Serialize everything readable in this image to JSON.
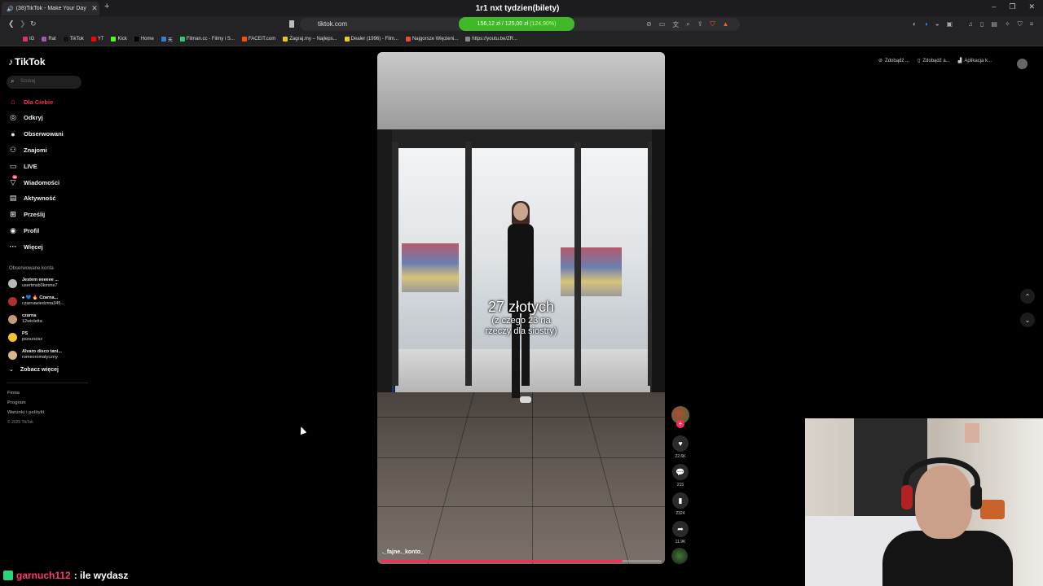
{
  "browser": {
    "tab_title": "(38)TikTok - Make Your Day",
    "tab_close": "✕",
    "new_tab": "+",
    "stream_title": "1r1 nxt tydzien(bilety)",
    "url": "tiktok.com",
    "goal": {
      "text": "156,12 zł / 125,00 zł",
      "percent_label": "(124,90%)",
      "color": "#41b72a"
    },
    "window_controls": [
      "–",
      "❐",
      "✕"
    ],
    "bookmarks": [
      {
        "label": "IG",
        "color": "#e1306c"
      },
      {
        "label": "Rat",
        "color": "#9b59b6"
      },
      {
        "label": "TikTok",
        "color": "#111111"
      },
      {
        "label": "YT",
        "color": "#ff0000"
      },
      {
        "label": "Kick",
        "color": "#53fc18"
      },
      {
        "label": "Home",
        "color": "#000000"
      },
      {
        "label": "天",
        "color": "#3a7bd5"
      },
      {
        "label": "Filman.cc - Filmy i S...",
        "color": "#2ecc71"
      },
      {
        "label": "FACEIT.com",
        "color": "#ff5500"
      },
      {
        "label": "Zagraj.my – Najleps...",
        "color": "#f1c40f"
      },
      {
        "label": "Dealer (1996) - Film...",
        "color": "#f5c518"
      },
      {
        "label": "Najgorsze Więzieni...",
        "color": "#e74c3c"
      },
      {
        "label": "https://youtu.be/ZR...",
        "color": "#888888"
      }
    ]
  },
  "tiktok": {
    "logo": "TikTok",
    "search_placeholder": "Szukaj",
    "nav": [
      {
        "label": "Dla Ciebie",
        "icon": "home-icon",
        "glyph": "⌂",
        "active": true
      },
      {
        "label": "Odkryj",
        "icon": "compass-icon",
        "glyph": "◎",
        "active": false
      },
      {
        "label": "Obserwowani",
        "icon": "following-icon",
        "glyph": "●",
        "active": false
      },
      {
        "label": "Znajomi",
        "icon": "friends-icon",
        "glyph": "⚇",
        "active": false
      },
      {
        "label": "LIVE",
        "icon": "live-icon",
        "glyph": "▭",
        "active": false
      },
      {
        "label": "Wiadomości",
        "icon": "messages-icon",
        "glyph": "▽",
        "active": false,
        "badge": "38"
      },
      {
        "label": "Aktywność",
        "icon": "activity-icon",
        "glyph": "▤",
        "active": false
      },
      {
        "label": "Prześlij",
        "icon": "upload-icon",
        "glyph": "⊞",
        "active": false
      },
      {
        "label": "Profil",
        "icon": "profile-icon",
        "glyph": "◉",
        "active": false
      },
      {
        "label": "Więcej",
        "icon": "more-icon",
        "glyph": "···",
        "active": false
      }
    ],
    "followed_title": "Obserwowane konta",
    "followed": [
      {
        "name": "Jestem eeeeee ...",
        "handle": "usertmsb0kmmx7",
        "color": "#b8b8b8"
      },
      {
        "name": "♠ 💙 🔥 Czarna...",
        "handle": "czarnawiedzma345...",
        "color": "#b03030"
      },
      {
        "name": "czarna",
        "handle": "12wioletta",
        "color": "#c49a7a"
      },
      {
        "name": "PS",
        "handle": "pszszszsz",
        "color": "#f4c430"
      },
      {
        "name": "Alvaro disco tani...",
        "handle": "romeoromatyczny",
        "color": "#d8b48a"
      }
    ],
    "see_more": "Zobacz więcej",
    "footer": [
      "Firma",
      "Program",
      "Warunki i polityki",
      "© 2025 TikTok"
    ],
    "promos": [
      "Zdobądź ...",
      "Zdobądź a...",
      "Aplikacja k..."
    ],
    "video": {
      "caption_big": "27 złotych",
      "caption_small_1": "(z czego 23 na",
      "caption_small_2": "rzeczy dla siostry)",
      "author": "._fajne._konto_",
      "progress": 0.86
    },
    "actions": {
      "likes": "22.6K",
      "comments": "215",
      "saves": "2324",
      "shares": "11.9K"
    }
  },
  "chat": {
    "user": "garnuch112",
    "message": ": ile wydasz"
  }
}
